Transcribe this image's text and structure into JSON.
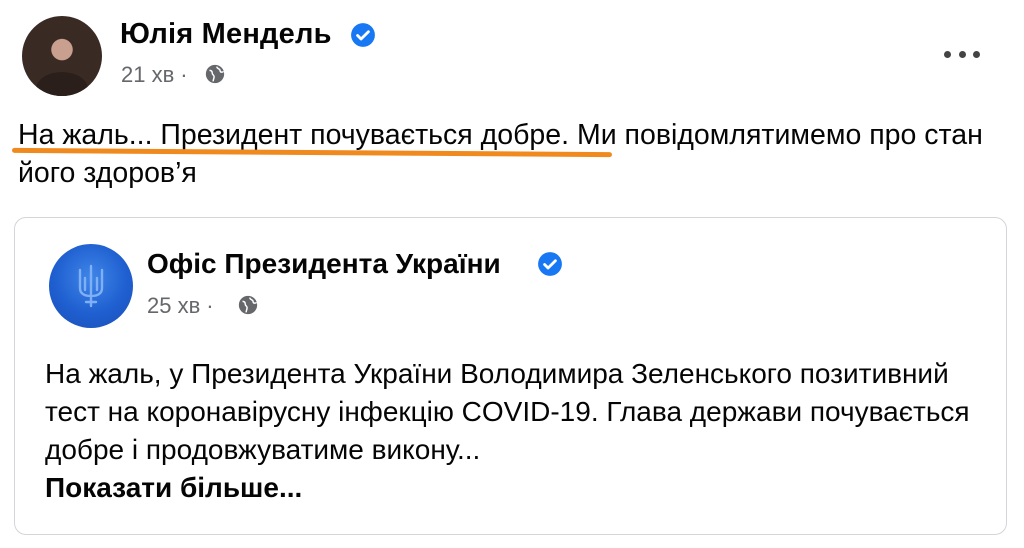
{
  "post": {
    "author": "Юлія Мендель",
    "time": "21 хв",
    "separator": "·",
    "text_highlighted": "На жаль... Президент почувається добре.",
    "text_rest": " Ми повідомлятимемо про стан його здоров’я",
    "underline_color": "#f18a1e"
  },
  "shared": {
    "page_name": "Офіс Президента України",
    "time": "25 хв",
    "separator": "·",
    "text": "На жаль, у Президента України Володимира Зеленського позитивний тест на коронавірусну інфекцію COVID-19. Глава держави почувається добре і продовжуватиме викону...",
    "see_more": "Показати більше..."
  },
  "colors": {
    "verified": "#1877f2",
    "muted_text": "#65676b"
  },
  "icons": [
    "verified-badge-icon",
    "globe-icon",
    "more-options-icon",
    "trident-icon"
  ]
}
